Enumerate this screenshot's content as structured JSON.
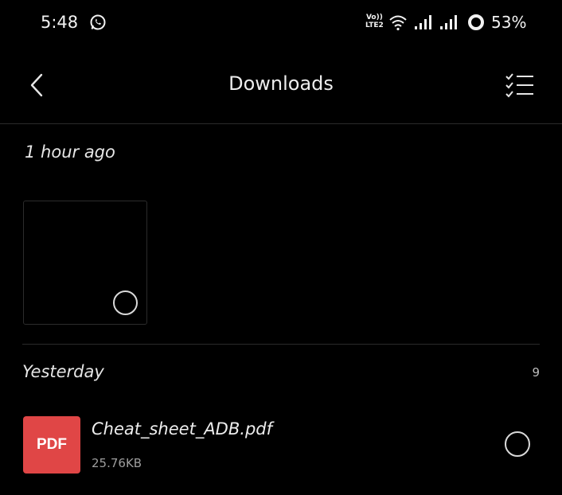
{
  "status_bar": {
    "time": "5:48",
    "volte_line1": "Vo))",
    "volte_line2": "LTE2",
    "battery_percent": "53%",
    "icons": [
      "whatsapp-icon",
      "wifi-icon",
      "signal-icon",
      "signal-icon",
      "battery-icon"
    ]
  },
  "header": {
    "title": "Downloads",
    "back_icon": "back-arrow-icon",
    "select_icon": "select-all-icon"
  },
  "sections": [
    {
      "label": "1 hour ago",
      "items": [
        {
          "type": "thumbnail",
          "selected": false
        }
      ]
    },
    {
      "label": "Yesterday",
      "count": "9",
      "items": [
        {
          "type": "file",
          "icon_label": "PDF",
          "name": "Cheat_sheet_ADB.pdf",
          "size": "25.76KB",
          "selected": false
        }
      ]
    }
  ],
  "colors": {
    "background": "#000000",
    "pdf_icon": "#e04646",
    "text": "#e6e6e6",
    "divider": "#2a2a2a"
  }
}
